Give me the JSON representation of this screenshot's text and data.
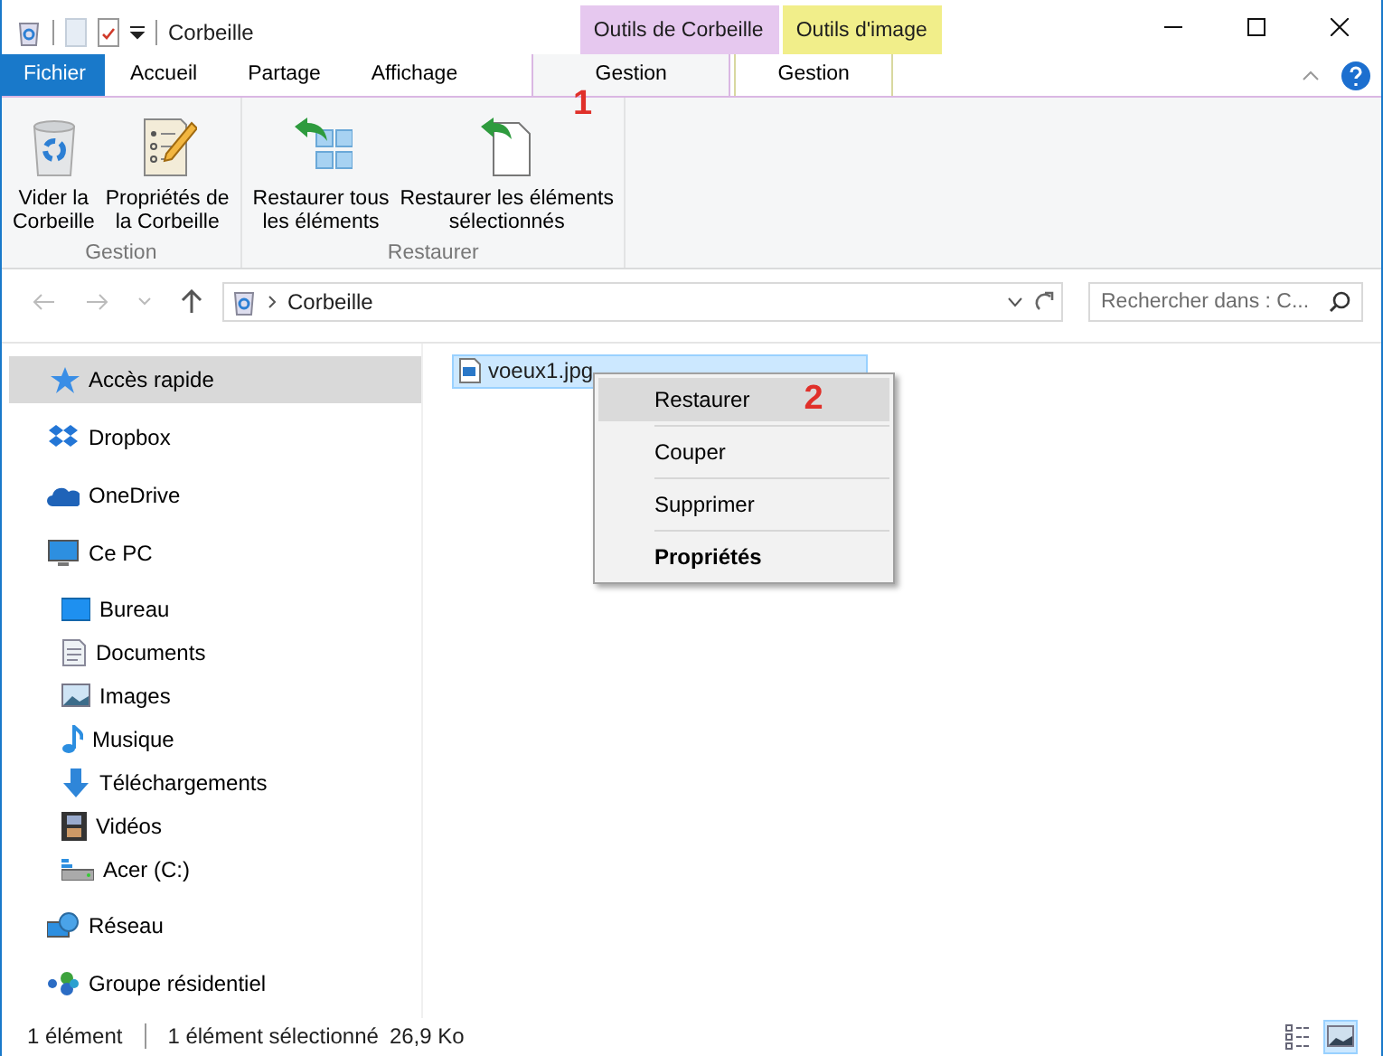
{
  "window": {
    "title": "Corbeille"
  },
  "context_groups": [
    {
      "label": "Outils de Corbeille",
      "color": "#e6c8ef"
    },
    {
      "label": "Outils d'image",
      "color": "#f1ee8a"
    }
  ],
  "ribbon_tabs": [
    {
      "label": "Fichier",
      "kind": "file",
      "selected": false
    },
    {
      "label": "Accueil",
      "kind": "normal",
      "selected": false
    },
    {
      "label": "Partage",
      "kind": "normal",
      "selected": false
    },
    {
      "label": "Affichage",
      "kind": "normal",
      "selected": false
    },
    {
      "label": "Gestion",
      "kind": "contextual",
      "selected": true
    },
    {
      "label": "Gestion",
      "kind": "contextual",
      "selected": false
    }
  ],
  "ribbon_groups": [
    {
      "label": "Gestion",
      "buttons": [
        {
          "label": "Vider la\nCorbeille",
          "kind": "bin"
        },
        {
          "label": "Propriétés de\nla Corbeille",
          "kind": "props"
        }
      ]
    },
    {
      "label": "Restaurer",
      "buttons": [
        {
          "label": "Restaurer tous\nles éléments",
          "kind": "restore-all"
        },
        {
          "label": "Restaurer les éléments\nsélectionnés",
          "kind": "restore-one"
        }
      ]
    }
  ],
  "address": {
    "path": "Corbeille",
    "search_placeholder": "Rechercher dans : C..."
  },
  "navigation": [
    {
      "label": "Accès rapide",
      "kind": "star",
      "selected": true
    },
    {
      "label": "Dropbox",
      "kind": "dropbox",
      "selected": false
    },
    {
      "label": "OneDrive",
      "kind": "cloud",
      "selected": false
    },
    {
      "label": "Ce PC",
      "kind": "pc",
      "selected": false,
      "children": [
        {
          "label": "Bureau",
          "kind": "desktop",
          "selected": false
        },
        {
          "label": "Documents",
          "kind": "doc",
          "selected": false
        },
        {
          "label": "Images",
          "kind": "image",
          "selected": false
        },
        {
          "label": "Musique",
          "kind": "music",
          "selected": false
        },
        {
          "label": "Téléchargements",
          "kind": "download",
          "selected": false
        },
        {
          "label": "Vidéos",
          "kind": "film",
          "selected": false
        },
        {
          "label": "Acer (C:)",
          "kind": "drive",
          "selected": false
        }
      ]
    },
    {
      "label": "Réseau",
      "kind": "network",
      "selected": false
    },
    {
      "label": "Groupe résidentiel",
      "kind": "homegroup",
      "selected": false
    }
  ],
  "files": [
    {
      "name": "voeux1.jpg",
      "selected": true
    }
  ],
  "context_menu": [
    {
      "label": "Restaurer",
      "bold": false,
      "selected": true
    },
    {
      "label": "Couper",
      "bold": false,
      "selected": false
    },
    {
      "label": "Supprimer",
      "bold": false,
      "selected": false
    },
    {
      "label": "Propriétés",
      "bold": true,
      "selected": false
    }
  ],
  "step_markers": [
    "1",
    "2"
  ],
  "status_bar": {
    "count": "1 élément",
    "selection": "1 élément sélectionné",
    "size": "26,9 Ko"
  },
  "view_buttons": [
    {
      "kind": "details",
      "selected": false
    },
    {
      "kind": "large-icons",
      "selected": true
    }
  ]
}
